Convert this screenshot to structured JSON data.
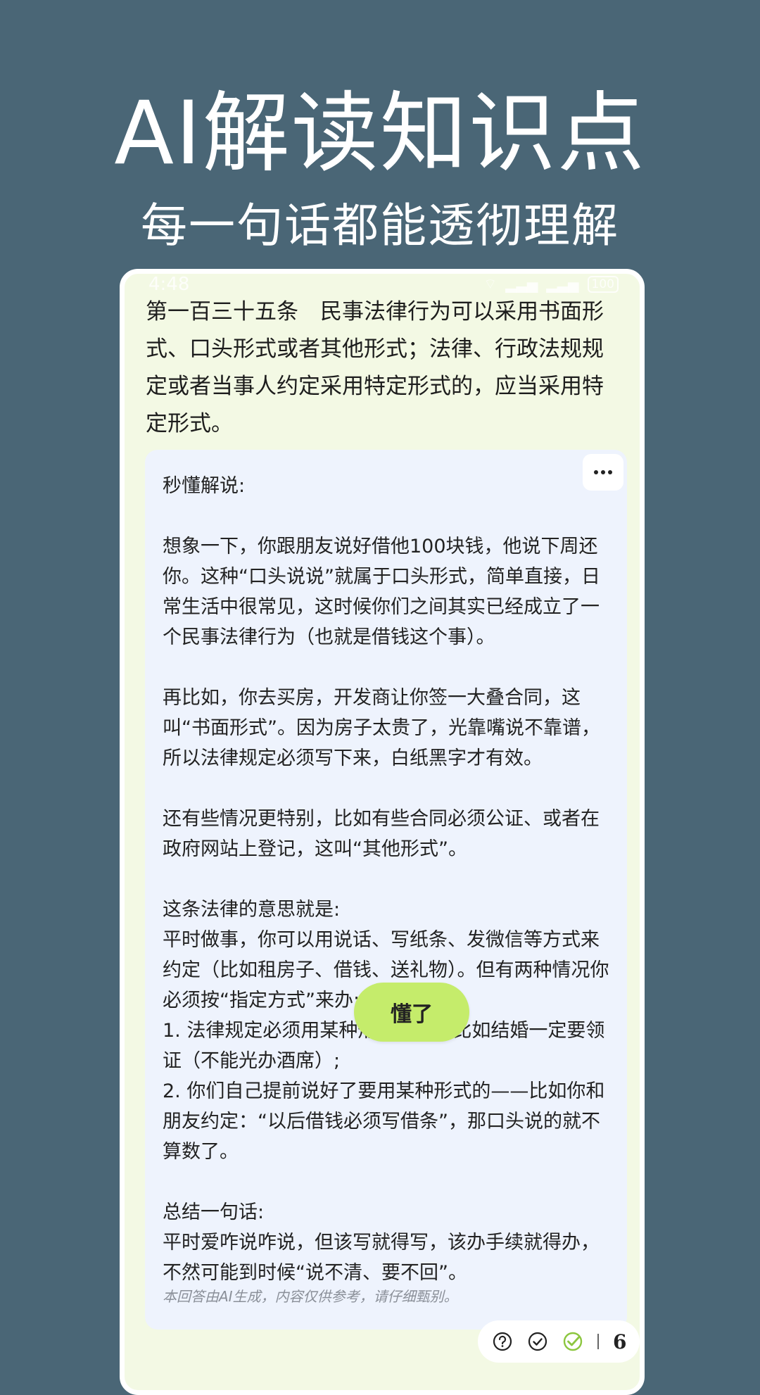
{
  "hero": {
    "title": "AI解读知识点",
    "subtitle": "每一句话都能透彻理解"
  },
  "status_bar": {
    "time": "4:48",
    "battery": "100"
  },
  "article": {
    "text": "第一百三十五条　民事法律行为可以采用书面形式、口头形式或者其他形式；法律、行政法规规定或者当事人约定采用特定形式的，应当采用特定形式。"
  },
  "explanation": {
    "text": "秒懂解说:\n\n想象一下，你跟朋友说好借他100块钱，他说下周还你。这种“口头说说”就属于口头形式，简单直接，日常生活中很常见，这时候你们之间其实已经成立了一个民事法律行为（也就是借钱这个事）。\n\n再比如，你去买房，开发商让你签一大叠合同，这叫“书面形式”。因为房子太贵了，光靠嘴说不靠谱，所以法律规定必须写下来，白纸黑字才有效。\n\n还有些情况更特别，比如有些合同必须公证、或者在政府网站上登记，这叫“其他形式”。\n\n这条法律的意思就是:\n平时做事，你可以用说话、写纸条、发微信等方式来约定（比如租房子、借钱、送礼物）。但有两种情况你必须按“指定方式”来办:\n1. 法律规定必须用某种形式的——比如结婚一定要领证（不能光办酒席）;\n2. 你们自己提前说好了要用某种形式的——比如你和朋友约定：“以后借钱必须写借条”，那口头说的就不算数了。\n\n总结一句话:\n平时爱咋说咋说，但该写就得写，该办手续就得办，不然可能到时候“说不清、要不回”。",
    "disclaimer": "本回答由AI生成，内容仅供参考，请仔细甄别。",
    "got_it_label": "懂了"
  },
  "toolbar": {
    "count": "6",
    "colors": {
      "check_green": "#8cc63f",
      "icon_dark": "#222222"
    }
  },
  "colors": {
    "background": "#4a6676",
    "article_bg": "#f3f9e4",
    "card_bg": "#eef3fd",
    "button_green": "#c5ec6b"
  }
}
